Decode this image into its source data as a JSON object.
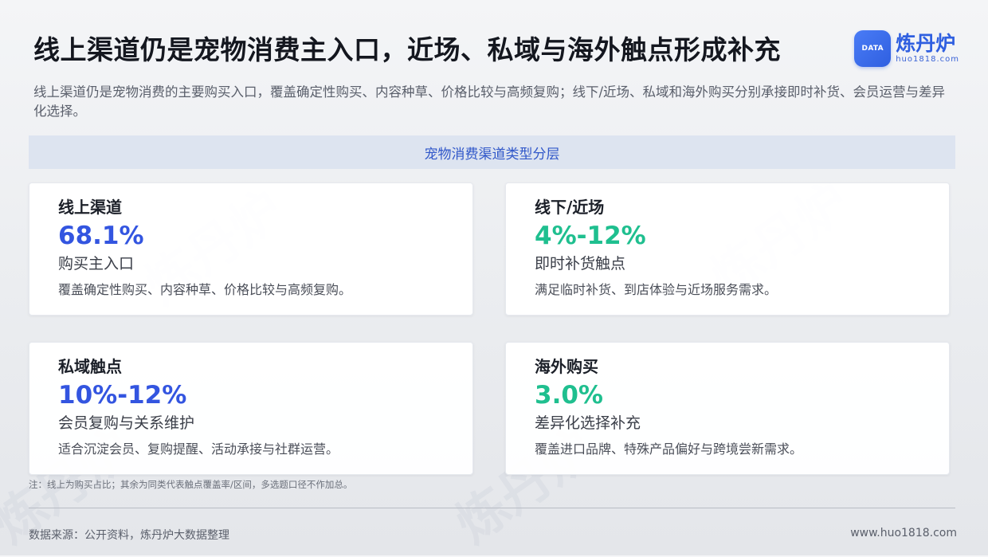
{
  "header": {
    "title": "线上渠道仍是宠物消费主入口，近场、私域与海外触点形成补充",
    "subtitle": "线上渠道仍是宠物消费的主要购买入口，覆盖确定性购买、内容种草、价格比较与高频复购；线下/近场、私域和海外购买分别承接即时补货、会员运营与差异化选择。"
  },
  "logo": {
    "mark_text": "DATA",
    "name": "炼丹炉",
    "url": "huo1818.com"
  },
  "section": {
    "banner": "宠物消费渠道类型分层"
  },
  "cards": [
    {
      "title": "线上渠道",
      "value": "68.1%",
      "label": "购买主入口",
      "desc": "覆盖确定性购买、内容种草、价格比较与高频复购。",
      "color": "#3355e0"
    },
    {
      "title": "线下/近场",
      "value": "4%-12%",
      "label": "即时补货触点",
      "desc": "满足临时补货、到店体验与近场服务需求。",
      "color": "#1fbf8f"
    },
    {
      "title": "私域触点",
      "value": "10%-12%",
      "label": "会员复购与关系维护",
      "desc": "适合沉淀会员、复购提醒、活动承接与社群运营。",
      "color": "#3355e0"
    },
    {
      "title": "海外购买",
      "value": "3.0%",
      "label": "差异化选择补充",
      "desc": "覆盖进口品牌、特殊产品偏好与跨境尝新需求。",
      "color": "#1fbf8f"
    }
  ],
  "footer": {
    "note": "注：线上为购买占比；其余为同类代表触点覆盖率/区间，多选题口径不作加总。",
    "source": "数据来源：公开资料，炼丹炉大数据整理",
    "site": "www.huo1818.com"
  },
  "watermark": {
    "text": "炼丹炉"
  }
}
